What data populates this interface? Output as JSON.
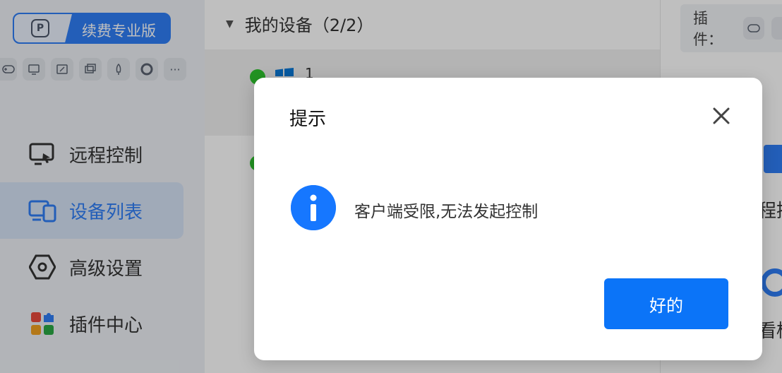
{
  "sidebar": {
    "brand_label": "续费专业版",
    "brand_icon": "P",
    "plugin_icons": [
      "gamepad-icon",
      "screen-share-icon",
      "edit-box-icon",
      "windows-icon",
      "rocket-icon",
      "lifebuoy-icon",
      "more-icon"
    ],
    "more_label": "···",
    "nav": [
      {
        "label": "远程控制",
        "icon": "remote-monitor-icon",
        "active": false
      },
      {
        "label": "设备列表",
        "icon": "devices-icon",
        "active": true
      },
      {
        "label": "高级设置",
        "icon": "hexagon-settings-icon",
        "active": false
      },
      {
        "label": "插件中心",
        "icon": "plugin-grid-icon",
        "active": false
      }
    ]
  },
  "main": {
    "group_title": "我的设备（2/2）",
    "devices": [
      {
        "name": "1",
        "status": "online"
      },
      {
        "name": "",
        "status": "online"
      }
    ]
  },
  "right_panel": {
    "plugins_label": "插件：",
    "partial_text_1": "程控",
    "partial_text_2": "看桂"
  },
  "dialog": {
    "title": "提示",
    "message": "客户端受限,无法发起控制",
    "ok_label": "好的",
    "info_glyph": "i"
  },
  "colors": {
    "accent": "#0b74f8",
    "online": "#2ec42e",
    "brand": "#2f7ef6"
  }
}
